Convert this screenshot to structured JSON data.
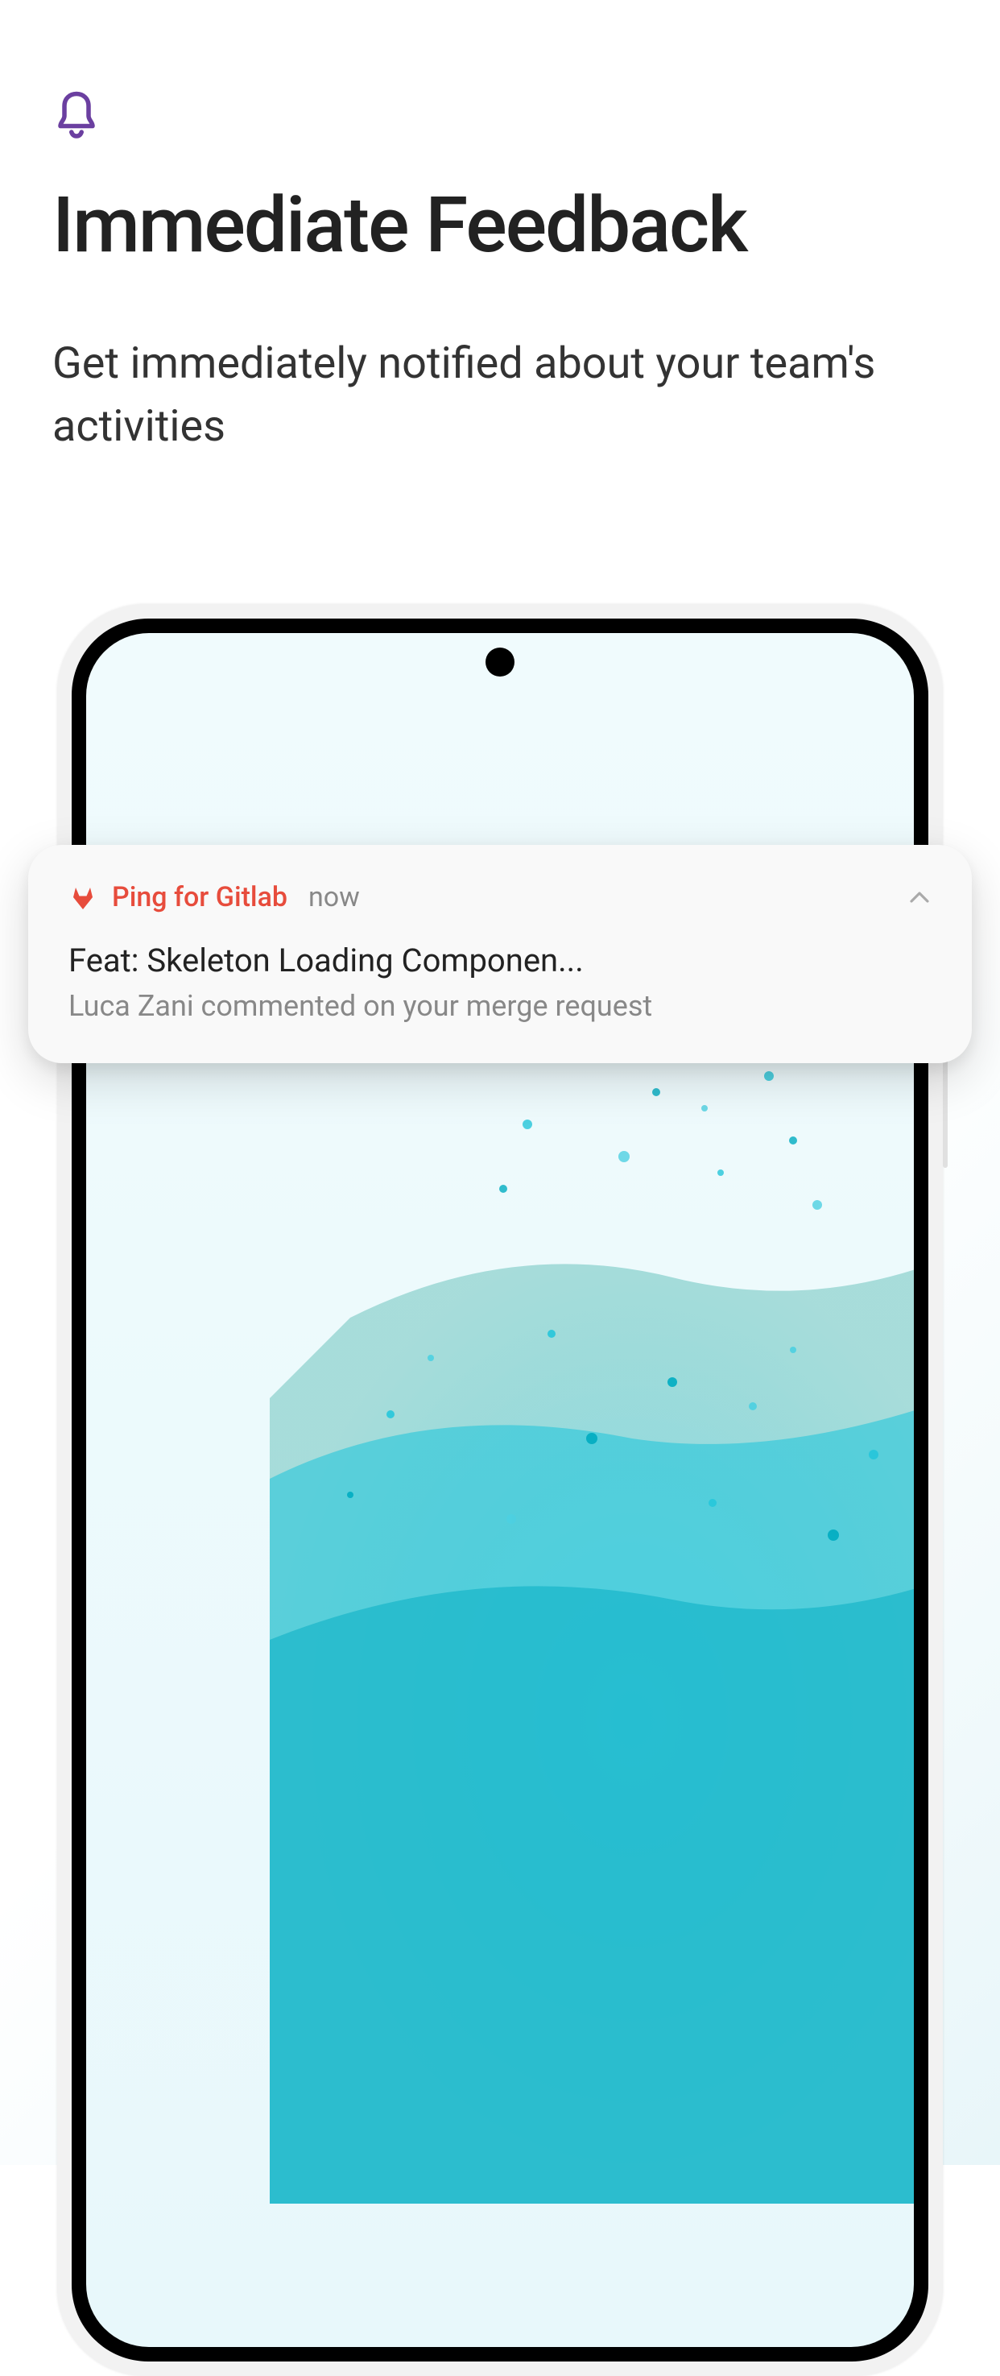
{
  "header": {
    "title": "Immediate Feedback",
    "subtitle": "Get immediately notified about your team's activities"
  },
  "notification": {
    "app_name": "Ping for Gitlab",
    "timestamp": "now",
    "title": "Feat: Skeleton Loading Componen...",
    "body": "Luca Zani commented on your merge request"
  },
  "colors": {
    "accent_purple": "#6b3fa0",
    "gitlab_orange": "#e74c3c",
    "teal": "#4dd0e1"
  }
}
